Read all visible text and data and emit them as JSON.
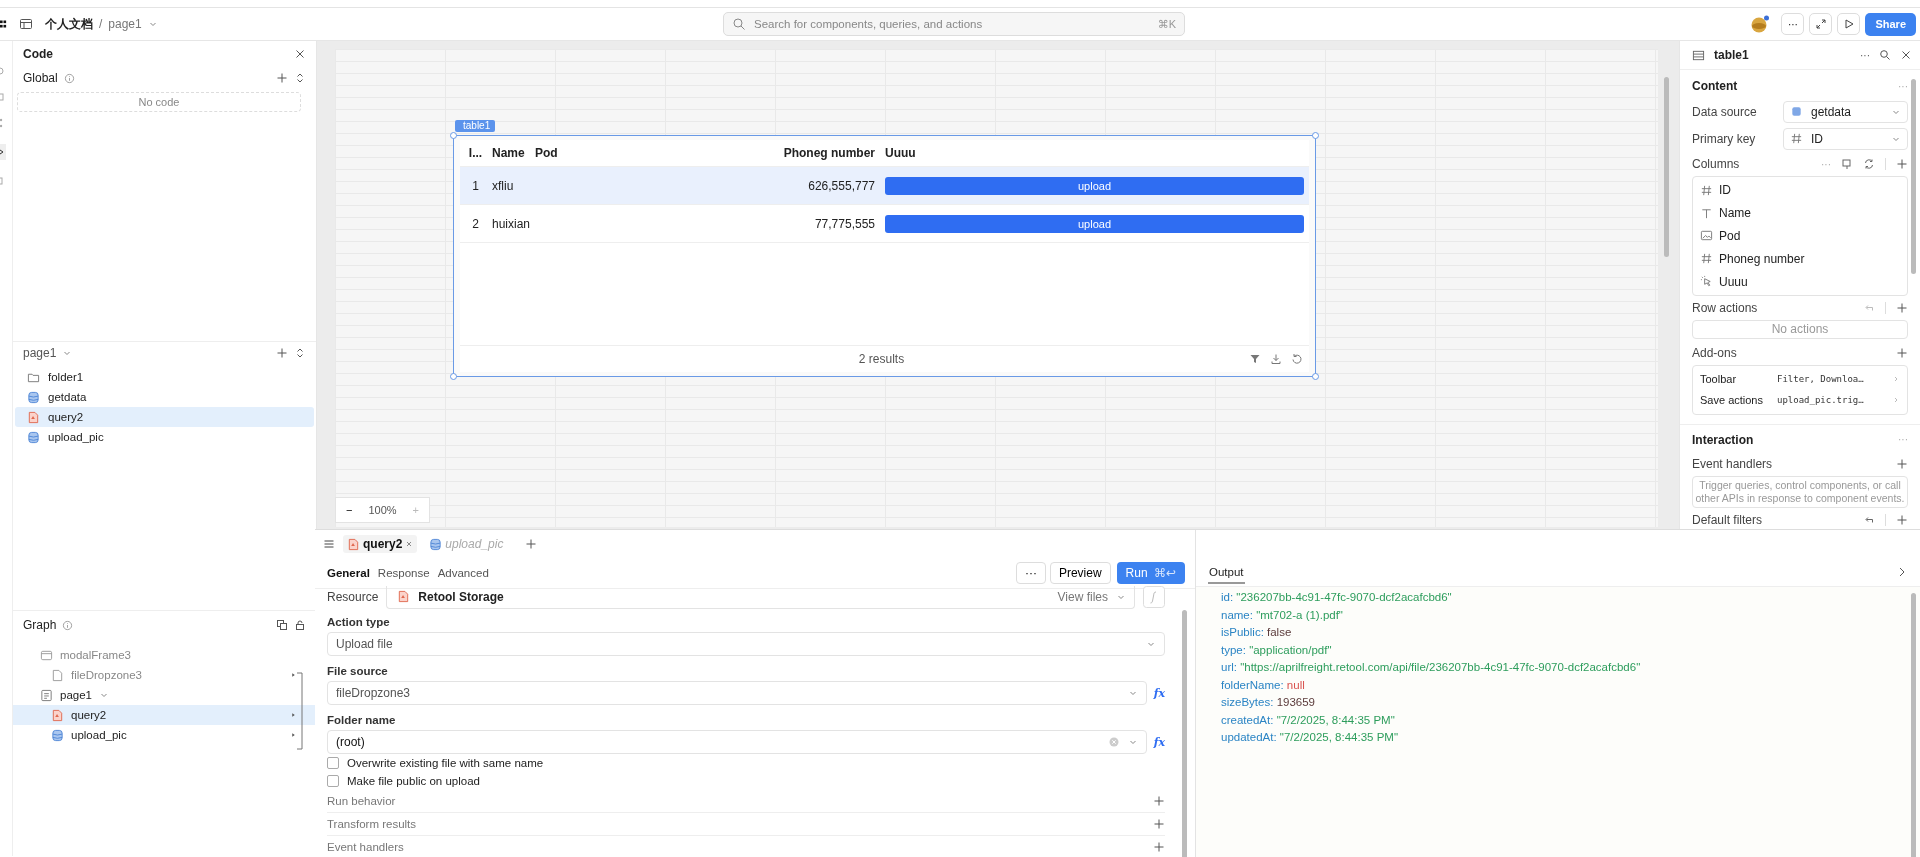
{
  "topbar": {
    "breadcrumb": "个人文档",
    "separator": "/",
    "page": "page1",
    "search_placeholder": "Search for components, queries, and actions",
    "search_shortcut": "⌘K",
    "more": "···",
    "share": "Share"
  },
  "code_panel": {
    "title": "Code",
    "global_label": "Global",
    "empty": "No code"
  },
  "page_panel": {
    "title": "page1",
    "items": [
      {
        "name": "folder1",
        "kind": "folder",
        "selected": false
      },
      {
        "name": "getdata",
        "kind": "database",
        "selected": false
      },
      {
        "name": "query2",
        "kind": "file",
        "selected": true
      },
      {
        "name": "upload_pic",
        "kind": "database",
        "selected": false
      }
    ]
  },
  "graph": {
    "title": "Graph",
    "nodes": [
      {
        "name": "modalFrame3",
        "kind": "frame",
        "dimmed": true,
        "selected": false,
        "children": [
          {
            "name": "fileDropzone3",
            "kind": "doc",
            "dimmed": true,
            "selected": false
          }
        ]
      },
      {
        "name": "page1",
        "kind": "page",
        "dimmed": false,
        "selected": false,
        "children": [
          {
            "name": "query2",
            "kind": "file",
            "dimmed": false,
            "selected": true
          },
          {
            "name": "upload_pic",
            "kind": "database",
            "dimmed": false,
            "selected": false
          }
        ]
      }
    ]
  },
  "canvas": {
    "component_label": "table1",
    "columns": [
      {
        "label": "I..."
      },
      {
        "label": "Name"
      },
      {
        "label": "Pod"
      },
      {
        "label": "Phoneg number"
      },
      {
        "label": "Uuuu"
      }
    ],
    "rows": [
      {
        "id": "1",
        "name": "xfliu",
        "pod": "",
        "phone": "626,555,777",
        "action": "upload",
        "selected": true
      },
      {
        "id": "2",
        "name": "huixian",
        "pod": "",
        "phone": "77,775,555",
        "action": "upload",
        "selected": false
      }
    ],
    "footer": "2 results",
    "zoom": {
      "minus": "−",
      "value": "100%",
      "plus": "+"
    }
  },
  "inspector": {
    "title": "table1",
    "more": "···",
    "content_title": "Content",
    "content_more": "···",
    "fields": [
      {
        "label": "Data source",
        "value": "getdata",
        "kind": "query"
      },
      {
        "label": "Primary key",
        "value": "ID",
        "kind": "number"
      }
    ],
    "columns_title": "Columns",
    "columns_more": "···",
    "columns": [
      {
        "name": "ID",
        "kind": "number"
      },
      {
        "name": "Name",
        "kind": "text"
      },
      {
        "name": "Pod",
        "kind": "image"
      },
      {
        "name": "Phoneg number",
        "kind": "number"
      },
      {
        "name": "Uuuu",
        "kind": "button"
      }
    ],
    "row_actions_title": "Row actions",
    "row_actions_empty": "No actions",
    "addons_title": "Add-ons",
    "addons": [
      {
        "label": "Toolbar",
        "value": "Filter, Downloa…"
      },
      {
        "label": "Save actions",
        "value": "upload_pic.trig…"
      }
    ],
    "interaction_title": "Interaction",
    "interaction_more": "···",
    "event_handlers_title": "Event handlers",
    "event_handlers_placeholder": "Trigger queries, control components, or call other APIs in response to component events.",
    "default_filters_title": "Default filters"
  },
  "editor": {
    "tabs": [
      {
        "label": "query2",
        "kind": "file",
        "selected": true
      },
      {
        "label": "upload_pic",
        "kind": "database",
        "selected": false
      }
    ],
    "subtabs": [
      {
        "label": "General",
        "selected": true
      },
      {
        "label": "Response",
        "selected": false
      },
      {
        "label": "Advanced",
        "selected": false
      }
    ],
    "more": "···",
    "preview": "Preview",
    "run": "Run",
    "run_shortcut": "⌘↩",
    "resource_label": "Resource",
    "resource": "Retool Storage",
    "view_files": "View files",
    "action_type_label": "Action type",
    "action_type": "Upload file",
    "file_source_label": "File source",
    "file_source": "fileDropzone3",
    "file_source_fx": "fx",
    "folder_label": "Folder name",
    "folder": "(root)",
    "folder_fx": "fx",
    "checkboxes": [
      {
        "label": "Overwrite existing file with same name",
        "checked": false
      },
      {
        "label": "Make file public on upload",
        "checked": false
      }
    ],
    "sections": [
      "Run behavior",
      "Transform results",
      "Event handlers"
    ]
  },
  "output": {
    "title": "Output",
    "lines": [
      {
        "key": "id:",
        "value": "\"236207bb-4c91-47fc-9070-dcf2acafcbd6\"",
        "kind": "string"
      },
      {
        "key": "name:",
        "value": "\"mt702-a (1).pdf\"",
        "kind": "string"
      },
      {
        "key": "isPublic:",
        "value": "false",
        "kind": "boolean"
      },
      {
        "key": "type:",
        "value": "\"application/pdf\"",
        "kind": "string"
      },
      {
        "key": "url:",
        "value": "\"https://aprilfreight.retool.com/api/file/236207bb-4c91-47fc-9070-dcf2acafcbd6\"",
        "kind": "string"
      },
      {
        "key": "folderName:",
        "value": "null",
        "kind": "null"
      },
      {
        "key": "sizeBytes:",
        "value": "193659",
        "kind": "number"
      },
      {
        "key": "createdAt:",
        "value": "\"7/2/2025, 8:44:35 PM\"",
        "kind": "string"
      },
      {
        "key": "updatedAt:",
        "value": "\"7/2/2025, 8:44:35 PM\"",
        "kind": "string"
      }
    ]
  }
}
